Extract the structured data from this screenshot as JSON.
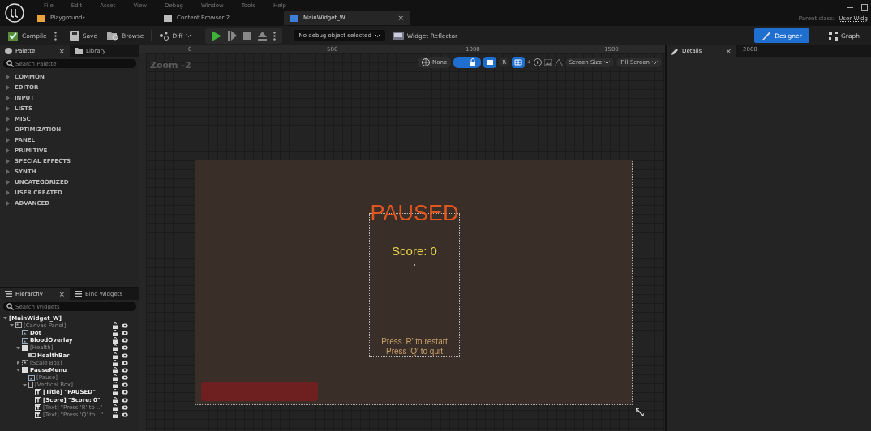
{
  "menu": [
    "File",
    "Edit",
    "Asset",
    "View",
    "Debug",
    "Window",
    "Tools",
    "Help"
  ],
  "tabs": [
    {
      "label": "Playground•",
      "kind": "level",
      "selected": false
    },
    {
      "label": "Content Browser 2",
      "kind": "folder",
      "selected": false
    },
    {
      "label": "MainWidget_W",
      "kind": "widget",
      "selected": true,
      "close": "×"
    }
  ],
  "parent_class": {
    "label": "Parent class:",
    "value": "User Widg"
  },
  "toolbar": {
    "compile": "Compile",
    "save": "Save",
    "browse": "Browse",
    "diff": "Diff",
    "debug": "No debug object selected",
    "reflector": "Widget Reflector"
  },
  "modes": [
    {
      "label": "Designer",
      "kind": "designer",
      "selected": true
    },
    {
      "label": "Graph",
      "kind": "graph",
      "selected": false
    }
  ],
  "palette": {
    "tabs": [
      {
        "label": "Palette",
        "kind": "palette",
        "selected": true,
        "close": "×"
      },
      {
        "label": "Library",
        "kind": "library",
        "selected": false
      }
    ],
    "placeholder": "Search Palette",
    "categories": [
      "COMMON",
      "EDITOR",
      "INPUT",
      "LISTS",
      "MISC",
      "OPTIMIZATION",
      "PANEL",
      "PRIMITIVE",
      "SPECIAL EFFECTS",
      "SYNTH",
      "UNCATEGORIZED",
      "USER CREATED",
      "ADVANCED"
    ]
  },
  "hierarchy": {
    "tabs": [
      {
        "label": "Hierarchy",
        "kind": "hierarchy",
        "selected": true,
        "close": "×"
      },
      {
        "label": "Bind Widgets",
        "kind": "bind",
        "selected": false
      }
    ],
    "placeholder": "Search Widgets",
    "tree": [
      {
        "label": "[MainWidget_W]",
        "kind": "root",
        "variable": true,
        "expanded": true,
        "children": [
          {
            "label": "[Canvas Panel]",
            "kind": "canvas",
            "variable": false,
            "expanded": true,
            "children": [
              {
                "label": "Dot",
                "kind": "image",
                "variable": true
              },
              {
                "label": "BloodOverlay",
                "kind": "image",
                "variable": true
              },
              {
                "label": "[Health]",
                "kind": "box",
                "variable": false,
                "expanded": true,
                "children": [
                  {
                    "label": "HealthBar",
                    "kind": "progress",
                    "variable": true
                  }
                ]
              },
              {
                "label": "[Scale Box]",
                "kind": "scale",
                "variable": false,
                "expanded": false
              },
              {
                "label": "PauseMenu",
                "kind": "box",
                "variable": true,
                "expanded": true,
                "children": [
                  {
                    "label": "[Pause]",
                    "kind": "image",
                    "variable": false
                  },
                  {
                    "label": "[Vertical Box]",
                    "kind": "vertical",
                    "variable": false,
                    "expanded": true,
                    "children": [
                      {
                        "label": "[Title] \"PAUSED\"",
                        "kind": "text",
                        "variable": true
                      },
                      {
                        "label": "[Score] \"Score: 0\"",
                        "kind": "text",
                        "variable": true
                      },
                      {
                        "label": "[Text] \"Press 'R' to ..\"",
                        "kind": "text",
                        "variable": false
                      },
                      {
                        "label": "[Text] \"Press 'Q' to ..\"",
                        "kind": "text",
                        "variable": false
                      }
                    ]
                  }
                ]
              }
            ]
          }
        ]
      }
    ]
  },
  "canvas": {
    "zoom": "Zoom -2",
    "ruler": [
      "0",
      "500",
      "1000",
      "1500",
      "2000"
    ],
    "tools": {
      "none": "None",
      "lock_on": true,
      "layout_on": true,
      "r": "R",
      "grid_on": true,
      "grid": "4",
      "screen_size": "Screen Size",
      "fill_screen": "Fill Screen"
    },
    "widget": {
      "title": "PAUSED",
      "score": "Score: 0",
      "hints": [
        "Press 'R' to restart",
        "Press 'Q' to quit"
      ],
      "health": {
        "level": 1
      }
    }
  },
  "details": {
    "tab": "Details",
    "close": "×"
  }
}
